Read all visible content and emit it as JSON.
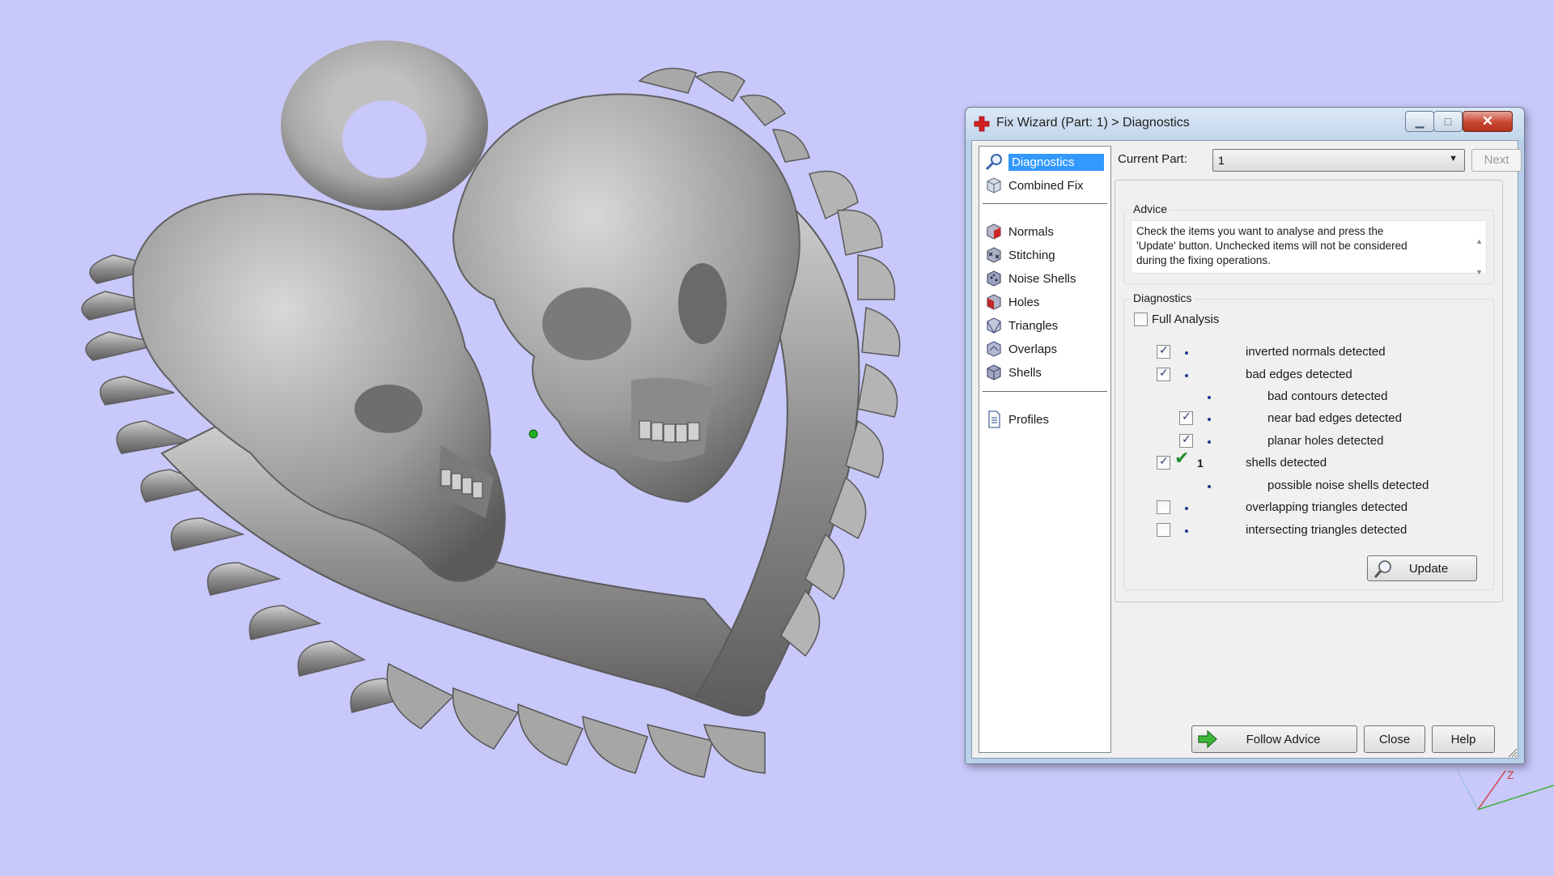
{
  "window": {
    "title": "Fix Wizard (Part: 1) > Diagnostics",
    "min_symbol": "▁",
    "max_symbol": "□",
    "close_symbol": "✕"
  },
  "nav": {
    "items": [
      {
        "label": "Diagnostics",
        "icon": "magnifier-icon",
        "selected": true
      },
      {
        "label": "Combined Fix",
        "icon": "cube-icon"
      },
      {
        "label": "Normals",
        "icon": "normals-cube-icon"
      },
      {
        "label": "Stitching",
        "icon": "stitching-cube-icon"
      },
      {
        "label": "Noise Shells",
        "icon": "noise-shells-icon"
      },
      {
        "label": "Holes",
        "icon": "holes-cube-icon"
      },
      {
        "label": "Triangles",
        "icon": "triangles-cube-icon"
      },
      {
        "label": "Overlaps",
        "icon": "overlaps-cube-icon"
      },
      {
        "label": "Shells",
        "icon": "shells-cube-icon"
      },
      {
        "label": "Profiles",
        "icon": "document-icon"
      }
    ]
  },
  "current_part": {
    "label": "Current Part:",
    "value": "1",
    "next_label": "Next"
  },
  "advice": {
    "title": "Advice",
    "text_line1": "Check the items you want to analyse and press the",
    "text_line2": "'Update' button. Unchecked items will not be considered",
    "text_line3": "during the fixing operations."
  },
  "diagnostics": {
    "title": "Diagnostics",
    "full_analysis_label": "Full Analysis",
    "full_analysis_checked": false,
    "rows": [
      {
        "label": "inverted normals detected",
        "checked": true,
        "indent": 0
      },
      {
        "label": "bad edges detected",
        "checked": true,
        "indent": 0
      },
      {
        "label": "bad contours detected",
        "checked": null,
        "indent": 1
      },
      {
        "label": "near bad edges detected",
        "checked": true,
        "indent": 1
      },
      {
        "label": "planar holes detected",
        "checked": true,
        "indent": 1
      },
      {
        "label": "shells detected",
        "checked": true,
        "indent": 0,
        "ok": true,
        "count": "1"
      },
      {
        "label": "possible noise shells detected",
        "checked": null,
        "indent": 1
      },
      {
        "label": "overlapping triangles detected",
        "checked": false,
        "indent": 0
      },
      {
        "label": "intersecting triangles detected",
        "checked": false,
        "indent": 0
      }
    ],
    "update_label": "Update"
  },
  "footer": {
    "follow_advice_label": "Follow Advice",
    "close_label": "Close",
    "help_label": "Help"
  },
  "axis": {
    "z_label": "Z"
  },
  "colors": {
    "viewport_bg": "#c8c8fa",
    "model_gray": "#9a9a9a",
    "selection_blue": "#3399ff",
    "ok_green": "#1f8f2a",
    "pivot_green": "#20b020"
  }
}
